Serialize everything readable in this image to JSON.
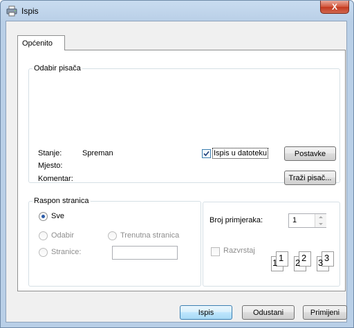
{
  "window": {
    "title": "Ispis",
    "close_glyph": "X",
    "title_icon": "printer-icon"
  },
  "tabs": [
    {
      "label": "Općenito"
    }
  ],
  "printer_group": {
    "legend": "Odabir pisača",
    "status_label": "Stanje:",
    "status_value": "Spreman",
    "location_label": "Mjesto:",
    "comment_label": "Komentar:",
    "print_to_file": {
      "label": "Ispis u datoteku",
      "checked": true
    },
    "preferences_button": "Postavke",
    "find_printer_button": "Traži pisač..."
  },
  "page_range": {
    "legend": "Raspon stranica",
    "options": [
      {
        "label": "Sve",
        "selected": true,
        "enabled": true
      },
      {
        "label": "Odabir",
        "selected": false,
        "enabled": false
      },
      {
        "label": "Trenutna stranica",
        "selected": false,
        "enabled": false
      },
      {
        "label": "Stranice:",
        "selected": false,
        "enabled": false
      }
    ],
    "pages_value": ""
  },
  "copies": {
    "label": "Broj primjeraka:",
    "value": "1",
    "collate": {
      "label": "Razvrstaj",
      "checked": false,
      "enabled": false
    },
    "collate_pages": [
      "1",
      "1",
      "2",
      "2",
      "3",
      "3"
    ]
  },
  "footer": {
    "print": "Ispis",
    "cancel": "Odustani",
    "apply": "Primijeni"
  }
}
